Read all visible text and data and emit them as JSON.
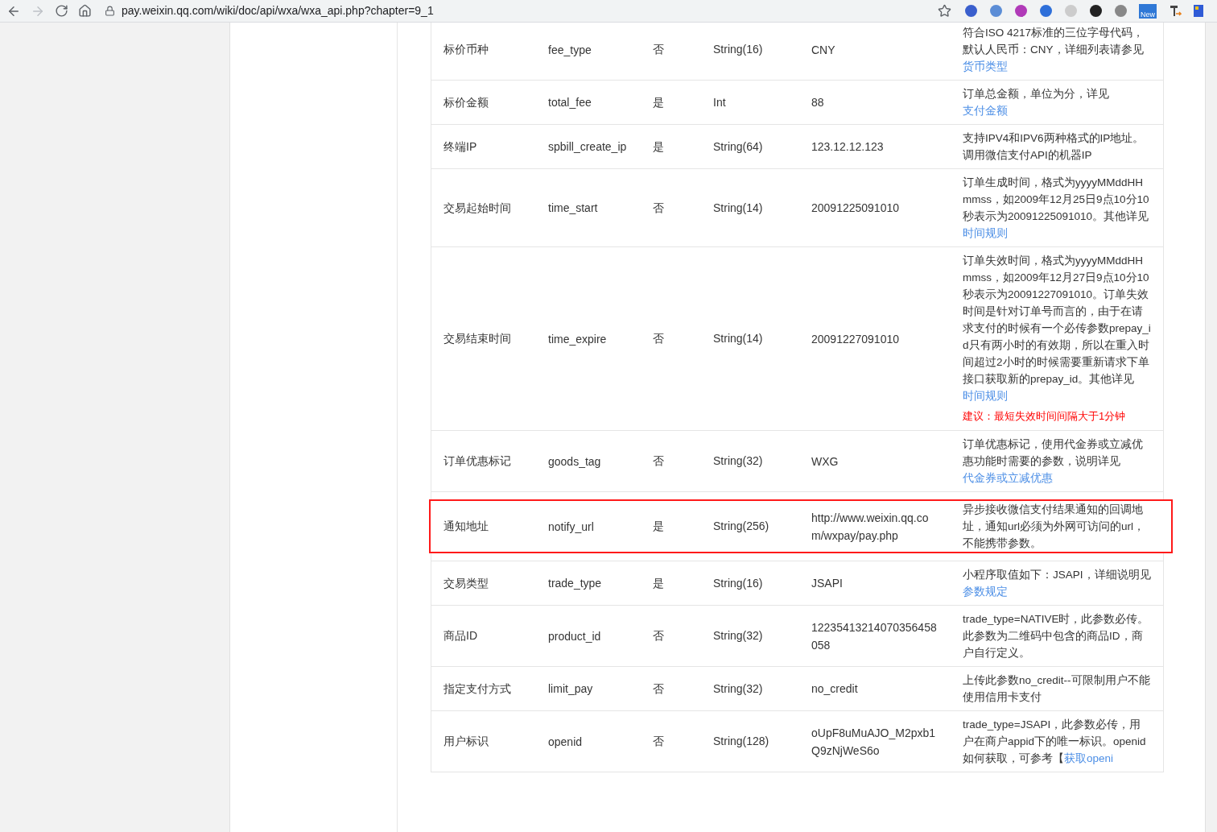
{
  "browser": {
    "url": "pay.weixin.qq.com/wiki/doc/api/wxa/wxa_api.php?chapter=9_1",
    "forward_disabled": true,
    "extension_badge": "New"
  },
  "rows": [
    {
      "name": "标价币种",
      "param": "fee_type",
      "required": "否",
      "type": "String(16)",
      "example": "CNY",
      "highlighted": false,
      "desc": [
        {
          "kind": "text",
          "text": "符合ISO 4217标准的三位字母代码，默认人民币：CNY，详细列表请参见"
        },
        {
          "kind": "link",
          "text": "货币类型"
        }
      ]
    },
    {
      "name": "标价金额",
      "param": "total_fee",
      "required": "是",
      "type": "Int",
      "example": "88",
      "highlighted": false,
      "desc": [
        {
          "kind": "text",
          "text": "订单总金额，单位为分，详见"
        },
        {
          "kind": "link",
          "text": "支付金额"
        }
      ]
    },
    {
      "name": "终端IP",
      "param": "spbill_create_ip",
      "required": "是",
      "type": "String(64)",
      "example": "123.12.12.123",
      "highlighted": false,
      "desc": [
        {
          "kind": "text",
          "text": "支持IPV4和IPV6两种格式的IP地址。调用微信支付API的机器IP"
        }
      ]
    },
    {
      "name": "交易起始时间",
      "param": "time_start",
      "required": "否",
      "type": "String(14)",
      "example": "20091225091010",
      "highlighted": false,
      "desc": [
        {
          "kind": "text",
          "text": "订单生成时间，格式为yyyyMMddHHmmss，如2009年12月25日9点10分10秒表示为20091225091010。其他详见"
        },
        {
          "kind": "link",
          "text": "时间规则"
        }
      ]
    },
    {
      "name": "交易结束时间",
      "param": "time_expire",
      "required": "否",
      "type": "String(14)",
      "example": "20091227091010",
      "highlighted": false,
      "desc": [
        {
          "kind": "text",
          "text": "订单失效时间，格式为yyyyMMddHHmmss，如2009年12月27日9点10分10秒表示为20091227091010。订单失效时间是针对订单号而言的，由于在请求支付的时候有一个必传参数prepay_id只有两小时的有效期，所以在重入时间超过2小时的时候需要重新请求下单接口获取新的prepay_id。其他详见"
        },
        {
          "kind": "link",
          "text": "时间规则"
        }
      ],
      "note": "建议：最短失效时间间隔大于1分钟"
    },
    {
      "name": "订单优惠标记",
      "param": "goods_tag",
      "required": "否",
      "type": "String(32)",
      "example": "WXG",
      "highlighted": false,
      "desc": [
        {
          "kind": "text",
          "text": "订单优惠标记，使用代金券或立减优惠功能时需要的参数，说明详见"
        },
        {
          "kind": "link",
          "text": "代金券或立减优惠"
        }
      ]
    },
    {
      "name": "通知地址",
      "param": "notify_url",
      "required": "是",
      "type": "String(256)",
      "example": "http://www.weixin.qq.com/wxpay/pay.php",
      "highlighted": true,
      "desc": [
        {
          "kind": "text",
          "text": "异步接收微信支付结果通知的回调地址，通知url必须为外网可访问的url，不能携带参数。"
        }
      ]
    },
    {
      "name": "交易类型",
      "param": "trade_type",
      "required": "是",
      "type": "String(16)",
      "example": "JSAPI",
      "highlighted": false,
      "desc": [
        {
          "kind": "text",
          "text": "小程序取值如下：JSAPI，详细说明见"
        },
        {
          "kind": "link",
          "text": "参数规定"
        }
      ]
    },
    {
      "name": "商品ID",
      "param": "product_id",
      "required": "否",
      "type": "String(32)",
      "example": "12235413214070356458058",
      "highlighted": false,
      "desc": [
        {
          "kind": "text",
          "text": "trade_type=NATIVE时，此参数必传。此参数为二维码中包含的商品ID，商户自行定义。"
        }
      ]
    },
    {
      "name": "指定支付方式",
      "param": "limit_pay",
      "required": "否",
      "type": "String(32)",
      "example": "no_credit",
      "highlighted": false,
      "desc": [
        {
          "kind": "text",
          "text": "上传此参数no_credit--可限制用户不能使用信用卡支付"
        }
      ]
    },
    {
      "name": "用户标识",
      "param": "openid",
      "required": "否",
      "type": "String(128)",
      "example": "oUpF8uMuAJO_M2pxb1Q9zNjWeS6o",
      "highlighted": false,
      "desc": [
        {
          "kind": "text",
          "text": "trade_type=JSAPI，此参数必传，用户在商户appid下的唯一标识。openid如何获取，可参考【"
        },
        {
          "kind": "link",
          "text": "获取openi"
        }
      ]
    }
  ]
}
